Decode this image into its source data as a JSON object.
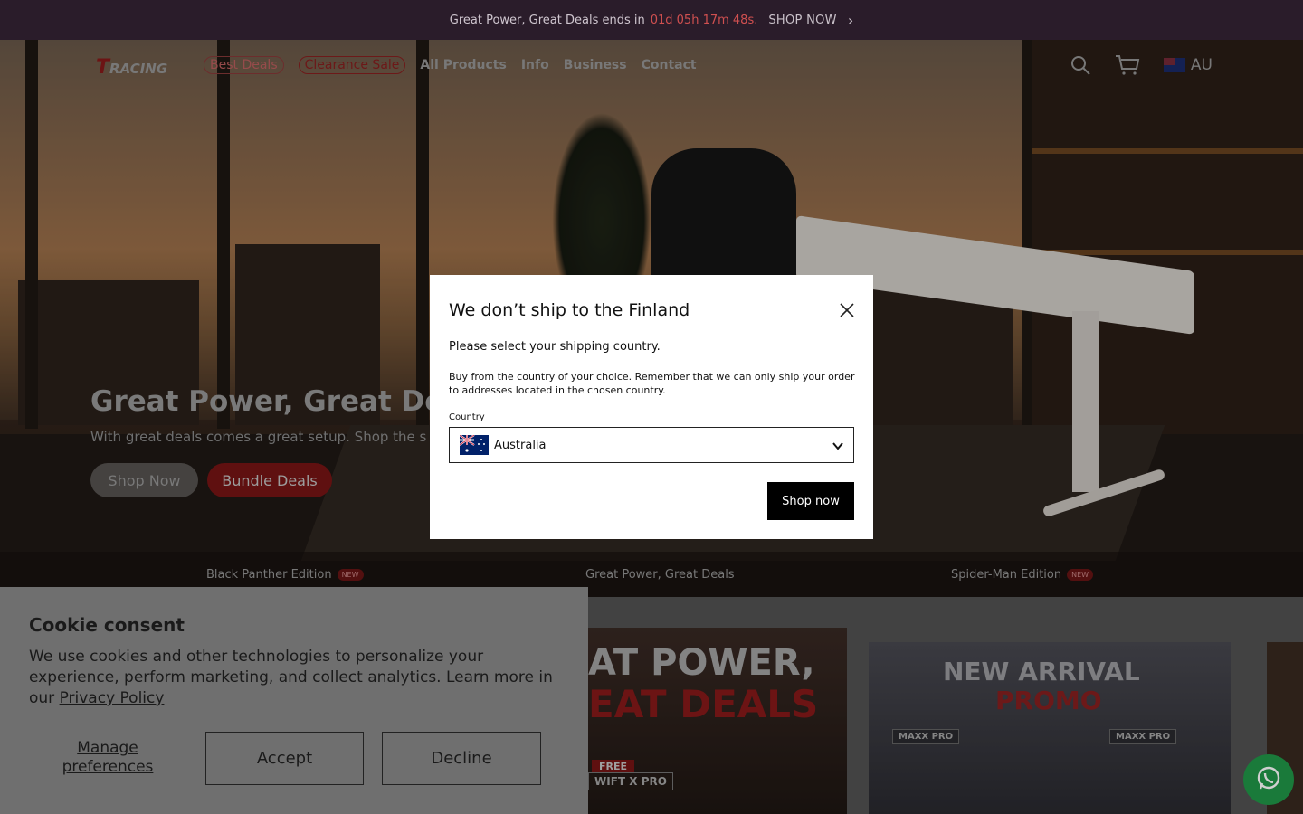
{
  "announcement": {
    "text": "Great Power, Great Deals ends in",
    "countdown": "01d 05h 17m 48s.",
    "cta": "SHOP NOW"
  },
  "header": {
    "logo": "RACING",
    "nav": [
      "Best Deals",
      "Clearance Sale",
      "All Products",
      "Info",
      "Business",
      "Contact"
    ],
    "country_code": "AU"
  },
  "hero": {
    "title": "Great Power, Great Deals",
    "subtitle": "With great deals comes a great setup. Shop the s",
    "primary_button": "Shop Now",
    "secondary_button": "Bundle Deals"
  },
  "subtabs": [
    {
      "label": "Black Panther Edition",
      "badge": "NEW"
    },
    {
      "label": "Great Power, Great Deals",
      "badge": ""
    },
    {
      "label": "Spider-Man Edition",
      "badge": "NEW"
    }
  ],
  "promos": {
    "p1": {
      "line1": "AT POWER,",
      "line2": "EAT DEALS",
      "free": "FREE",
      "name": "WIFT X PRO"
    },
    "p2": {
      "line1": "NEW ARRIVAL",
      "line2": "PROMO",
      "left": "MAXX PRO",
      "right": "MAXX PRO"
    }
  },
  "modal": {
    "title": "We don’t ship to the Finland",
    "prompt": "Please select your shipping country.",
    "body": "Buy from the country of your choice. Remember that we can only ship your order to addresses located in the chosen country.",
    "country_label": "Country",
    "selected_country": "Australia",
    "button": "Shop now"
  },
  "cookie": {
    "title": "Cookie consent",
    "text": "We use cookies and other technologies to personalize your experience, perform marketing, and collect analytics. Learn more in our",
    "link": "Privacy Policy",
    "manage": "Manage preferences",
    "accept": "Accept",
    "decline": "Decline"
  },
  "colors": {
    "countdown": "#d05050",
    "modal_button": "#000000",
    "bundle_button": "#7a1414"
  }
}
